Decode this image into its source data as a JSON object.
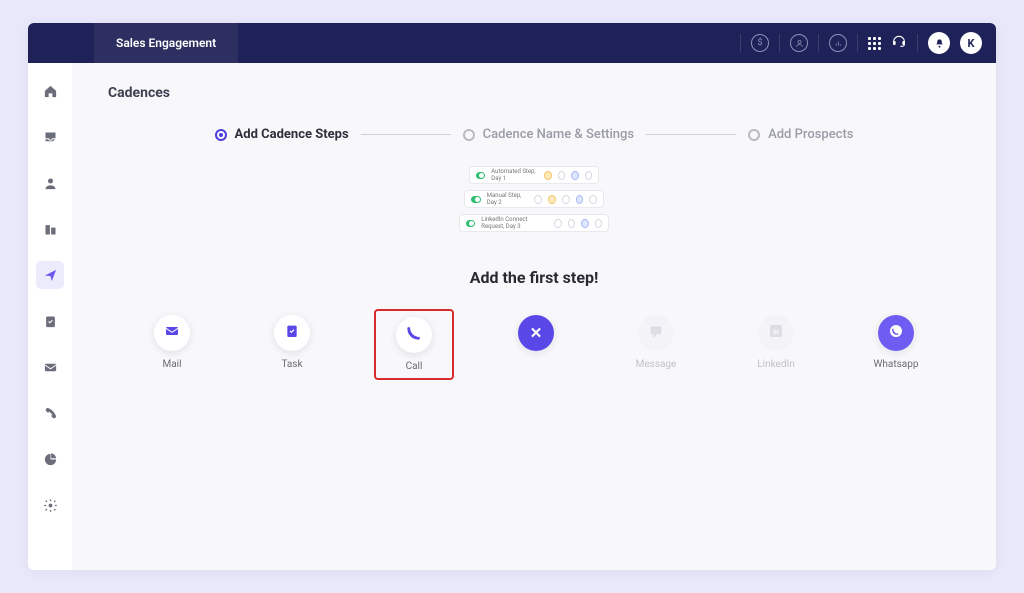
{
  "header": {
    "module": "Sales Engagement",
    "avatar_initial": "K"
  },
  "page": {
    "title": "Cadences"
  },
  "stepper": {
    "steps": [
      {
        "label": "Add Cadence Steps",
        "active": true
      },
      {
        "label": "Cadence Name & Settings",
        "active": false
      },
      {
        "label": "Add Prospects",
        "active": false
      }
    ]
  },
  "preview_rows": [
    "Automated Step, Day 1",
    "Manual Step, Day 2",
    "LinkedIn Connect Request, Day 3"
  ],
  "add_first_heading": "Add the first step!",
  "choices": {
    "mail": "Mail",
    "task": "Task",
    "call": "Call",
    "message": "Message",
    "linkedin": "LinkedIn",
    "whatsapp": "Whatsapp"
  },
  "icon_colors": {
    "mail": "#5a47e8",
    "task": "#5a47e8",
    "call": "#5a47e8",
    "message": "#b7b7c5",
    "linkedin": "#b7b7c5",
    "whatsapp": "#ffffff"
  },
  "colors": {
    "accent": "#5a47e8",
    "highlight_border": "#d92b2b",
    "topbar": "#1f2259"
  }
}
